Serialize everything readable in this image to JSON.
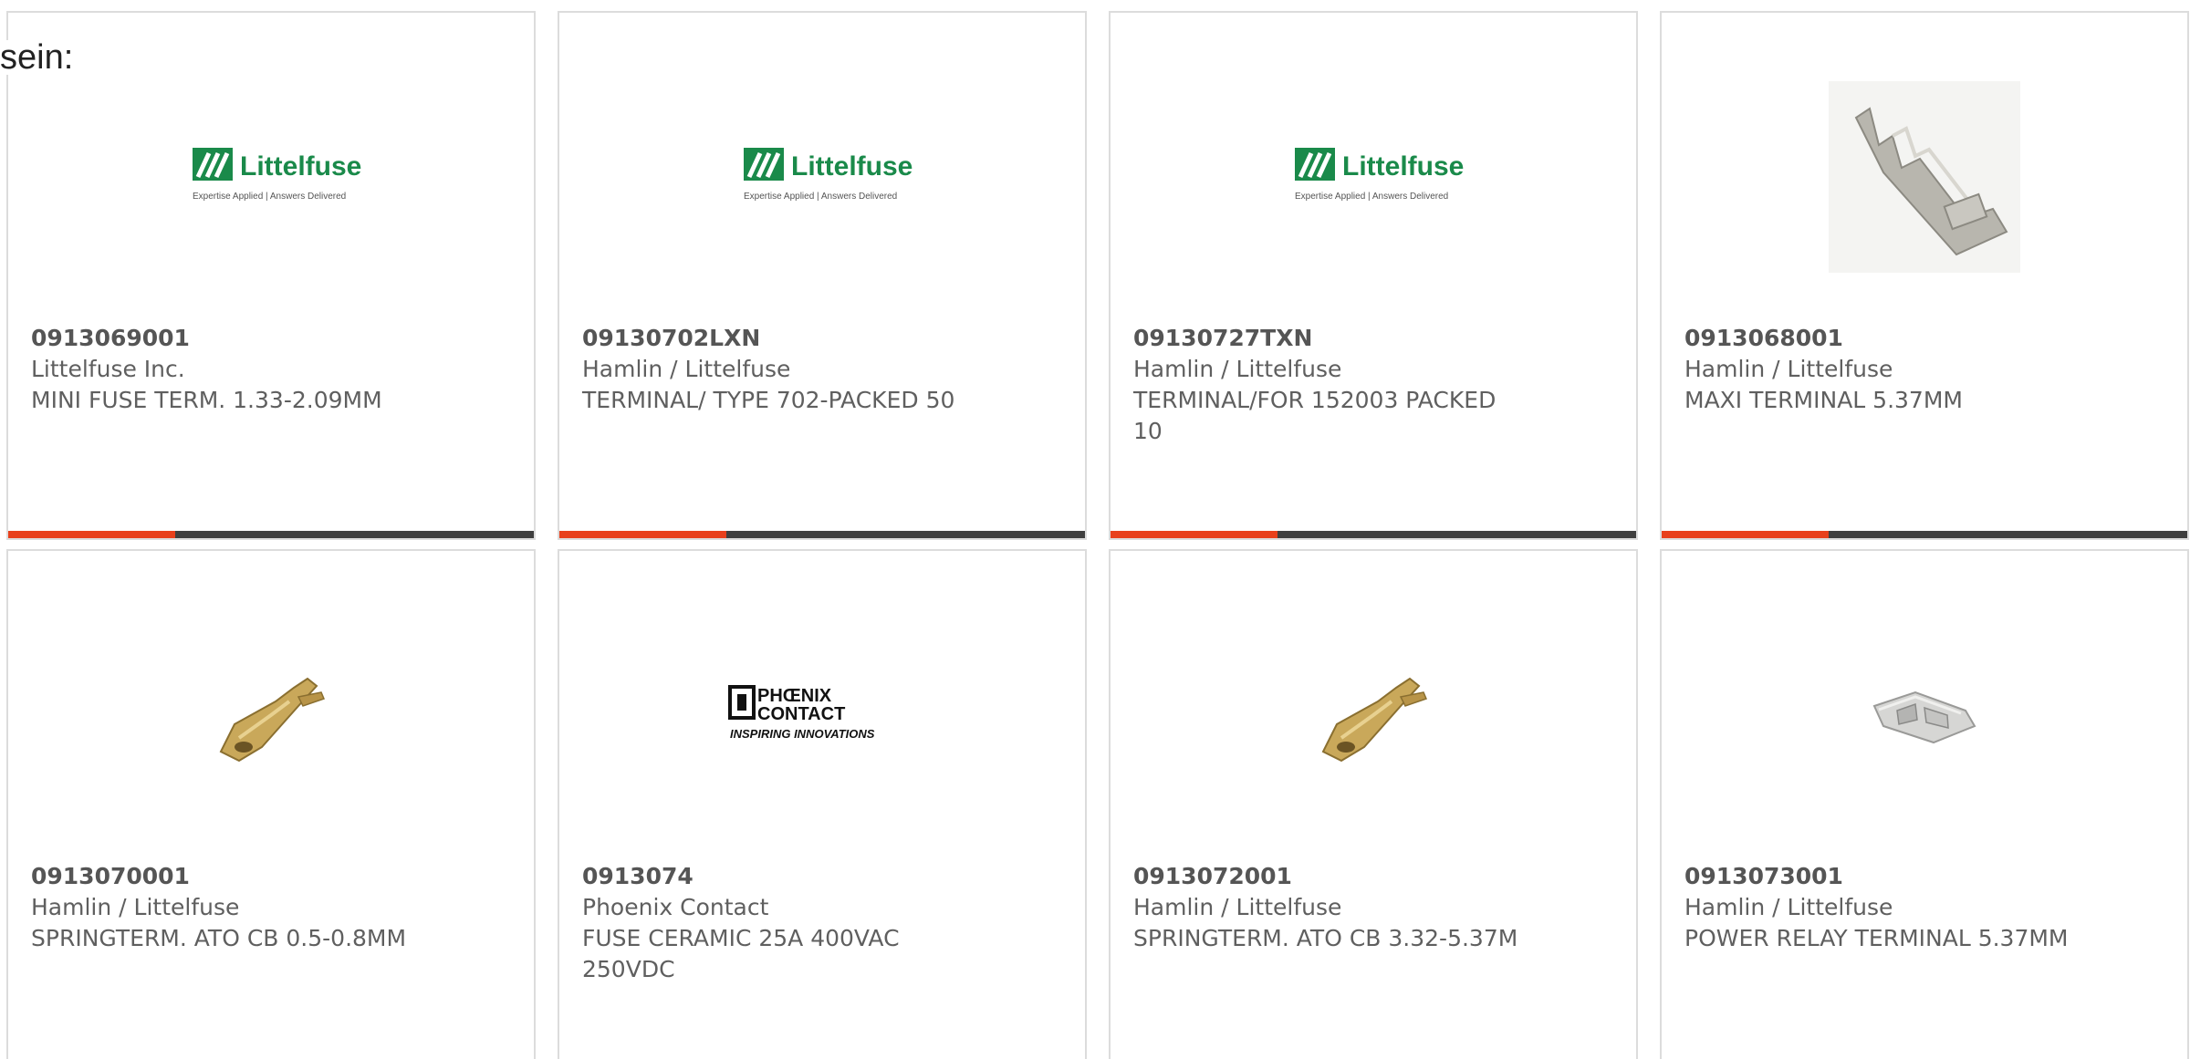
{
  "intro_text": "sein:",
  "colors": {
    "accent": "#e8401c",
    "bar": "#3f3f3f",
    "text": "#5f5f5f",
    "border": "#dcdcdc",
    "littelfuse_green": "#1a8a4a"
  },
  "logos": {
    "littelfuse": {
      "name": "Littelfuse",
      "tagline": "Expertise Applied | Answers Delivered"
    },
    "phoenix": {
      "line1": "PHŒNIX",
      "line2": "CONTACT",
      "tagline": "INSPIRING INNOVATIONS"
    }
  },
  "products": [
    {
      "image": "littelfuse-logo",
      "part_number": "0913069001",
      "manufacturer": "Littelfuse Inc.",
      "description": "MINI FUSE TERM. 1.33-2.09MM"
    },
    {
      "image": "littelfuse-logo",
      "part_number": "09130702LXN",
      "manufacturer": "Hamlin / Littelfuse",
      "description": "TERMINAL/ TYPE 702-PACKED 50"
    },
    {
      "image": "littelfuse-logo",
      "part_number": "09130727TXN",
      "manufacturer": "Hamlin / Littelfuse",
      "description": "TERMINAL/FOR 152003 PACKED 10"
    },
    {
      "image": "maxi-terminal-photo",
      "part_number": "0913068001",
      "manufacturer": "Hamlin / Littelfuse",
      "description": "MAXI TERMINAL 5.37MM"
    },
    {
      "image": "brass-spring-terminal-photo",
      "part_number": "0913070001",
      "manufacturer": "Hamlin / Littelfuse",
      "description": "SPRINGTERM. ATO CB 0.5-0.8MM"
    },
    {
      "image": "phoenix-contact-logo",
      "part_number": "0913074",
      "manufacturer": "Phoenix Contact",
      "description": "FUSE CERAMIC 25A 400VAC 250VDC"
    },
    {
      "image": "brass-spring-terminal-photo",
      "part_number": "0913072001",
      "manufacturer": "Hamlin / Littelfuse",
      "description": "SPRINGTERM. ATO CB 3.32-5.37M"
    },
    {
      "image": "silver-relay-terminal-photo",
      "part_number": "0913073001",
      "manufacturer": "Hamlin / Littelfuse",
      "description": "POWER RELAY TERMINAL 5.37MM"
    }
  ]
}
